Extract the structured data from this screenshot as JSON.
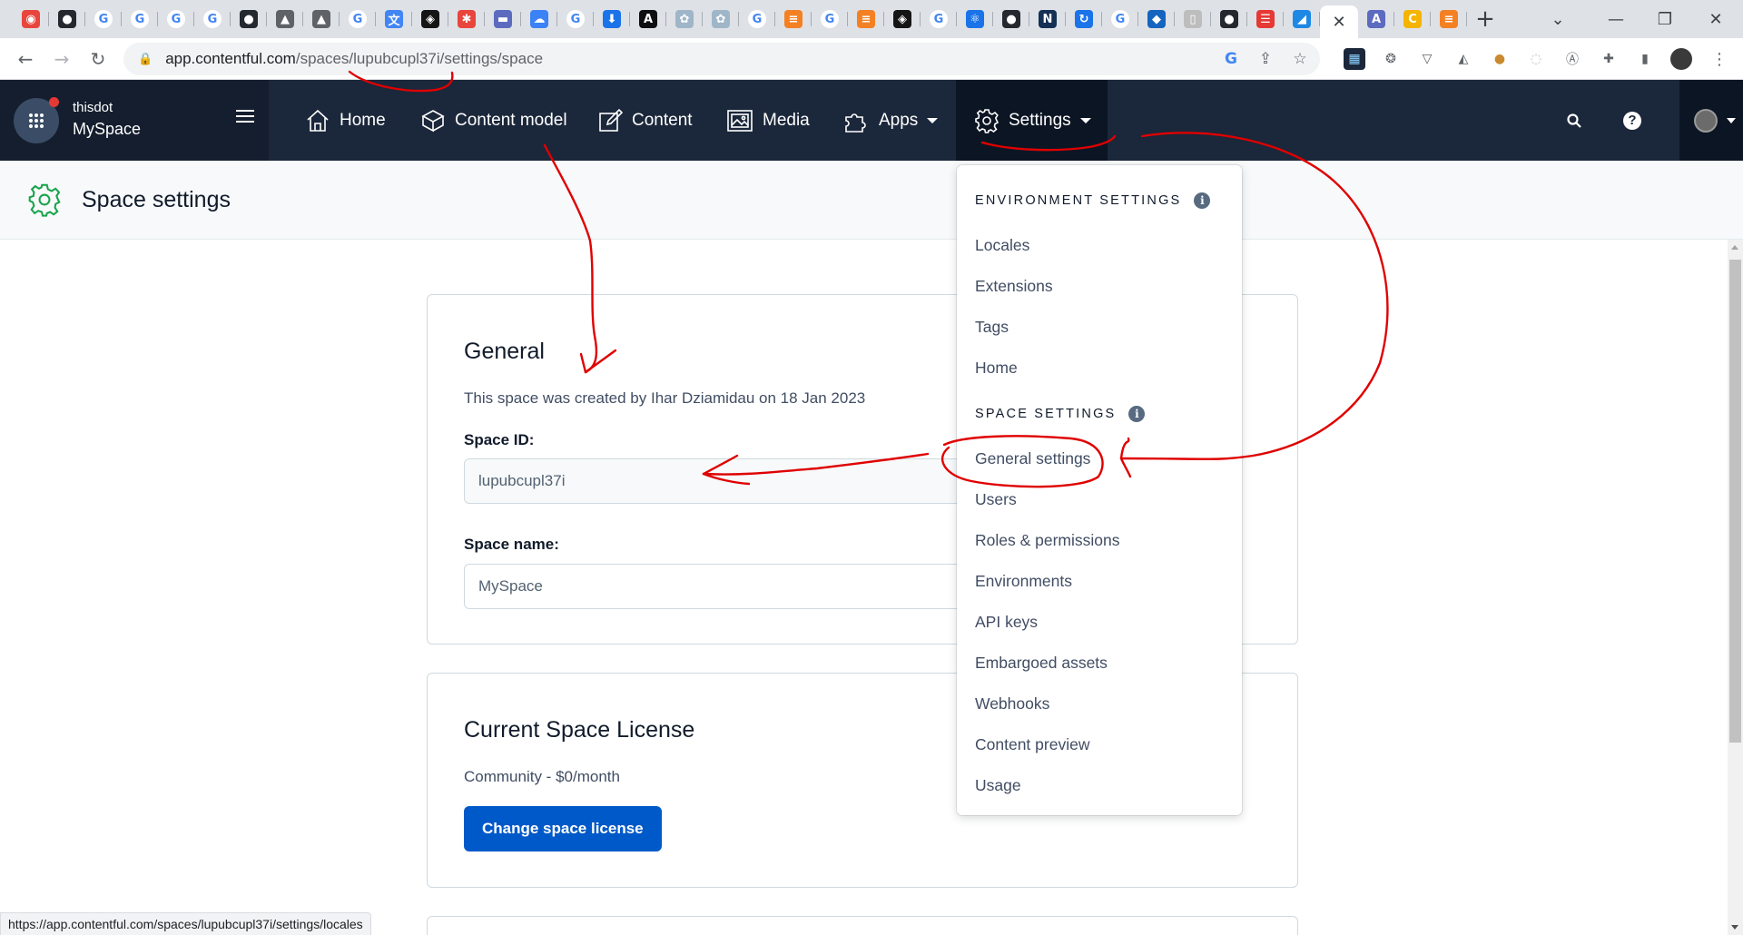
{
  "browser": {
    "url_host": "app.contentful.com",
    "url_path": "/spaces/lupubcupl37i/settings/space",
    "active_tab_close": "✕",
    "new_tab": "+",
    "status_url": "https://app.contentful.com/spaces/lupubcupl37i/settings/locales",
    "tabs": [
      {
        "icon": "chrome-icon",
        "glyph": "◉",
        "color": "#e8453c"
      },
      {
        "icon": "github-icon",
        "glyph": "●",
        "color": "#24292f"
      },
      {
        "icon": "google-icon",
        "glyph": "G",
        "color": "#4285f4"
      },
      {
        "icon": "google-icon",
        "glyph": "G",
        "color": "#4285f4"
      },
      {
        "icon": "google-icon",
        "glyph": "G",
        "color": "#4285f4"
      },
      {
        "icon": "google-icon",
        "glyph": "G",
        "color": "#4285f4"
      },
      {
        "icon": "github-icon",
        "glyph": "●",
        "color": "#24292f"
      },
      {
        "icon": "image-icon",
        "glyph": "▲",
        "color": "#5f6368"
      },
      {
        "icon": "image-icon",
        "glyph": "▲",
        "color": "#5f6368"
      },
      {
        "icon": "google-icon",
        "glyph": "G",
        "color": "#4285f4"
      },
      {
        "icon": "translate-icon",
        "glyph": "文",
        "color": "#4285f4"
      },
      {
        "icon": "codesandbox-icon",
        "glyph": "◈",
        "color": "#151515"
      },
      {
        "icon": "asterisk-icon",
        "glyph": "✱",
        "color": "#e8453c"
      },
      {
        "icon": "window-icon",
        "glyph": "▬",
        "color": "#5c6bc0"
      },
      {
        "icon": "cloud-icon",
        "glyph": "☁",
        "color": "#3b82f6"
      },
      {
        "icon": "google-icon",
        "glyph": "G",
        "color": "#4285f4"
      },
      {
        "icon": "download-icon",
        "glyph": "⬇",
        "color": "#1a73e8"
      },
      {
        "icon": "angular-icon",
        "glyph": "A",
        "color": "#0f0f11"
      },
      {
        "icon": "flower-icon",
        "glyph": "✿",
        "color": "#9fb6c8"
      },
      {
        "icon": "flower-icon",
        "glyph": "✿",
        "color": "#9fb6c8"
      },
      {
        "icon": "google-icon",
        "glyph": "G",
        "color": "#4285f4"
      },
      {
        "icon": "stackoverflow-icon",
        "glyph": "≡",
        "color": "#f48024"
      },
      {
        "icon": "google-icon",
        "glyph": "G",
        "color": "#4285f4"
      },
      {
        "icon": "stackoverflow-icon",
        "glyph": "≡",
        "color": "#f48024"
      },
      {
        "icon": "codesandbox-icon",
        "glyph": "◈",
        "color": "#151515"
      },
      {
        "icon": "google-icon",
        "glyph": "G",
        "color": "#4285f4"
      },
      {
        "icon": "react-icon",
        "glyph": "⚛",
        "color": "#1a73e8"
      },
      {
        "icon": "github-icon",
        "glyph": "●",
        "color": "#24292f"
      },
      {
        "icon": "nx-icon",
        "glyph": "N",
        "color": "#143055"
      },
      {
        "icon": "reload-icon",
        "glyph": "↻",
        "color": "#1a73e8"
      },
      {
        "icon": "google-icon",
        "glyph": "G",
        "color": "#4285f4"
      },
      {
        "icon": "code-icon",
        "glyph": "◆",
        "color": "#1565c0"
      },
      {
        "icon": "blank-page-icon",
        "glyph": "▯",
        "color": "#bdbdbd"
      },
      {
        "icon": "github-icon",
        "glyph": "●",
        "color": "#24292f"
      },
      {
        "icon": "list-icon",
        "glyph": "☰",
        "color": "#e53935"
      },
      {
        "icon": "vscode-icon",
        "glyph": "◢",
        "color": "#1e88e5"
      }
    ],
    "tabs_after": [
      {
        "icon": "a-circle-icon",
        "glyph": "A",
        "color": "#5c6bc0"
      },
      {
        "icon": "colorful-c-icon",
        "glyph": "C",
        "color": "#f4b400"
      },
      {
        "icon": "stackoverflow-icon",
        "glyph": "≡",
        "color": "#f48024"
      }
    ]
  },
  "app": {
    "org_name": "thisdot",
    "space_name": "MySpace",
    "nav": {
      "home": "Home",
      "content_model": "Content model",
      "content": "Content",
      "media": "Media",
      "apps": "Apps",
      "settings": "Settings"
    },
    "page_title": "Space settings"
  },
  "general": {
    "heading": "General",
    "created_text": "This space was created by Ihar Dziamidau on 18 Jan 2023",
    "space_id_label": "Space ID:",
    "space_id_value": "lupubcupl37i",
    "space_name_label": "Space name:",
    "space_name_value": "MySpace"
  },
  "license": {
    "heading": "Current Space License",
    "plan": "Community - $0/month",
    "button": "Change space license"
  },
  "menu": {
    "env_heading": "ENVIRONMENT SETTINGS",
    "env_items": [
      "Locales",
      "Extensions",
      "Tags",
      "Home"
    ],
    "space_heading": "SPACE SETTINGS",
    "space_items": [
      "General settings",
      "Users",
      "Roles & permissions",
      "Environments",
      "API keys",
      "Embargoed assets",
      "Webhooks",
      "Content preview",
      "Usage"
    ],
    "info_glyph": "i"
  },
  "colors": {
    "appbar": "#1b273a",
    "primary": "#0059c8",
    "annotation": "#e00000"
  }
}
